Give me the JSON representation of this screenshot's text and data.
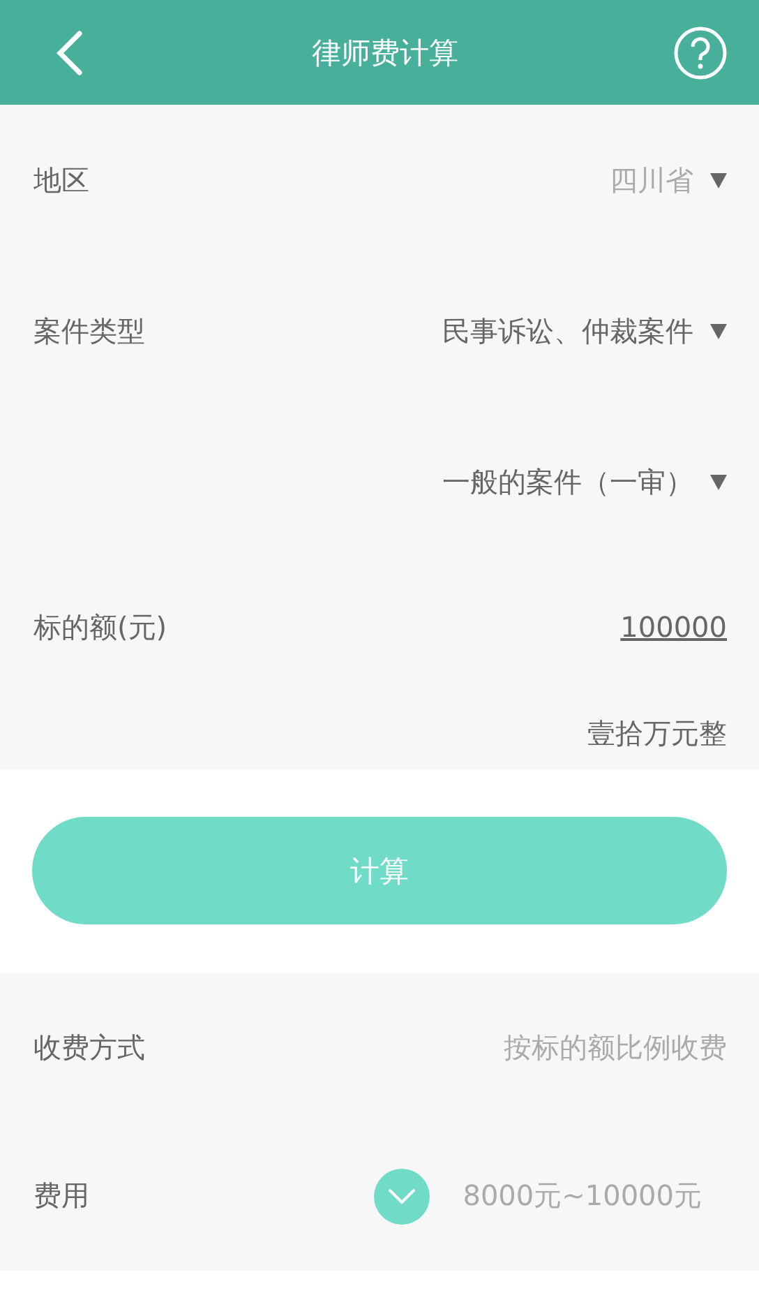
{
  "header": {
    "title": "律师费计算"
  },
  "form": [
    {
      "kind": "select",
      "label": "地区",
      "value": "四川省",
      "muted": true
    },
    {
      "kind": "select",
      "label": "案件类型",
      "value": "民事诉讼、仲裁案件",
      "muted": false
    },
    {
      "kind": "select",
      "value": "一般的案件（一审）",
      "muted": false
    },
    {
      "kind": "input",
      "label": "标的额(元)",
      "value": "100000"
    },
    {
      "kind": "note",
      "value": "壹拾万元整"
    }
  ],
  "calculate_button": "计算",
  "result": [
    {
      "kind": "text",
      "label": "收费方式",
      "value": "按标的额比例收费"
    },
    {
      "kind": "expand",
      "label": "费用",
      "value": "8000元~10000元",
      "expanded": false
    }
  ]
}
